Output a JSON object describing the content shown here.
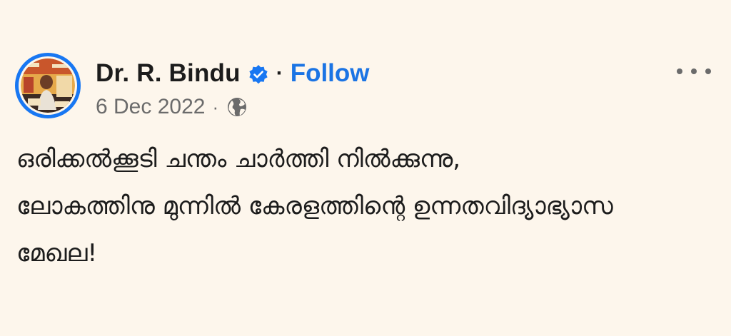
{
  "post": {
    "author": {
      "name": "Dr. R. Bindu",
      "verified": true,
      "verified_icon": "verified-badge-icon",
      "verified_color": "#1877f2"
    },
    "separator": "·",
    "follow_label": "Follow",
    "follow_color": "#1b74e4",
    "meta": {
      "date": "6 Dec 2022",
      "separator": "·",
      "audience_icon": "globe-icon"
    },
    "more_icon": "more-options-icon",
    "body_lines": [
      "ഒരിക്കൽക്കൂടി ചന്തം ചാർത്തി നിൽക്കുന്നു,",
      "ലോകത്തിനു മുന്നിൽ കേരളത്തിന്റെ ഉന്നതവിദ്യാഭ്യാസ",
      "മേഖല!"
    ]
  },
  "colors": {
    "background": "#fdf6ec",
    "text": "#1c1c1c",
    "muted": "#6b6b6b",
    "avatar_ring": "#1877f2"
  }
}
